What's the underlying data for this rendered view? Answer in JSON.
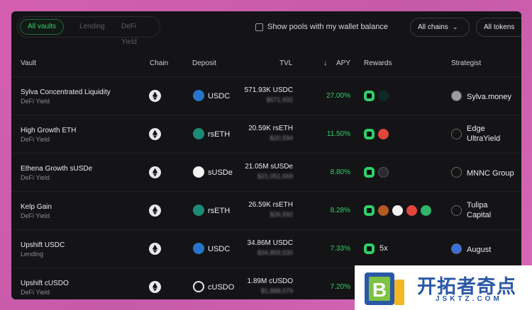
{
  "filters": {
    "tabs": [
      {
        "label": "All vaults",
        "active": true
      },
      {
        "label": "Lending",
        "active": false
      },
      {
        "label": "DeFi Yield",
        "active": false
      }
    ],
    "wallet_checkbox_label": "Show pools with my wallet balance",
    "wallet_checkbox_checked": false,
    "chains_dropdown": "All chains",
    "tokens_dropdown": "All tokens"
  },
  "columns": {
    "vault": "Vault",
    "chain": "Chain",
    "deposit": "Deposit",
    "tvl": "TVL",
    "apy": "APY",
    "rewards": "Rewards",
    "strategist": "Strategist"
  },
  "colors": {
    "accent": "#2fd06a",
    "panel": "#141416"
  },
  "rows": [
    {
      "name": "Sylva Concentrated Liquidity",
      "type": "DeFi Yield",
      "chain_icon": "ethereum-icon",
      "token": "USDC",
      "token_icon": "usdc-icon",
      "tvl": "571.93K USDC",
      "tvl_usd": "$571,932",
      "apy": "27.00%",
      "rewards": [
        "fuel-icon",
        "mellow-icon"
      ],
      "multiplier": "",
      "strategist": "Sylva.money",
      "strategist_line2": "",
      "strategist_icon": "sylva-icon"
    },
    {
      "name": "High Growth ETH",
      "type": "DeFi Yield",
      "chain_icon": "ethereum-icon",
      "token": "rsETH",
      "token_icon": "rseth-icon",
      "tvl": "20.59K rsETH",
      "tvl_usd": "$20,594",
      "apy": "11.50%",
      "rewards": [
        "fuel-icon",
        "ether-fi-icon"
      ],
      "multiplier": "",
      "strategist": "Edge",
      "strategist_line2": "UltraYield",
      "strategist_icon": "edge-icon"
    },
    {
      "name": "Ethena Growth sUSDe",
      "type": "DeFi Yield",
      "chain_icon": "ethereum-icon",
      "token": "sUSDe",
      "token_icon": "susde-icon",
      "tvl": "21.05M sUSDe",
      "tvl_usd": "$21,051,659",
      "apy": "8.80%",
      "rewards": [
        "fuel-icon",
        "ethena-icon"
      ],
      "multiplier": "",
      "strategist": "MNNC Group",
      "strategist_line2": "",
      "strategist_icon": "mnnc-icon"
    },
    {
      "name": "Kelp Gain",
      "type": "DeFi Yield",
      "chain_icon": "ethereum-icon",
      "token": "rsETH",
      "token_icon": "rseth-icon",
      "tvl": "26.59K rsETH",
      "tvl_usd": "$26,592",
      "apy": "8.28%",
      "rewards": [
        "fuel-icon",
        "kelp-icon",
        "linea-icon",
        "ether-fi-icon",
        "symbiotic-icon"
      ],
      "multiplier": "",
      "strategist": "Tulipa",
      "strategist_line2": "Capital",
      "strategist_icon": "tulipa-icon"
    },
    {
      "name": "Upshift USDC",
      "type": "Lending",
      "chain_icon": "ethereum-icon",
      "token": "USDC",
      "token_icon": "usdc-icon",
      "tvl": "34.86M USDC",
      "tvl_usd": "$34,859,530",
      "apy": "7.33%",
      "rewards": [
        "fuel-icon"
      ],
      "multiplier": "5x",
      "strategist": "August",
      "strategist_line2": "",
      "strategist_icon": "august-icon"
    },
    {
      "name": "Upshift cUSDO",
      "type": "DeFi Yield",
      "chain_icon": "ethereum-icon",
      "token": "cUSDO",
      "token_icon": "cusdo-icon",
      "tvl": "1.89M cUSDO",
      "tvl_usd": "$1,888,079",
      "apy": "7.20%",
      "rewards": [],
      "multiplier": "",
      "strategist": "",
      "strategist_line2": "",
      "strategist_icon": ""
    }
  ],
  "watermark": {
    "cn": "开拓者奇点",
    "url": "JSKTZ.COM",
    "logo_letter": "B"
  }
}
